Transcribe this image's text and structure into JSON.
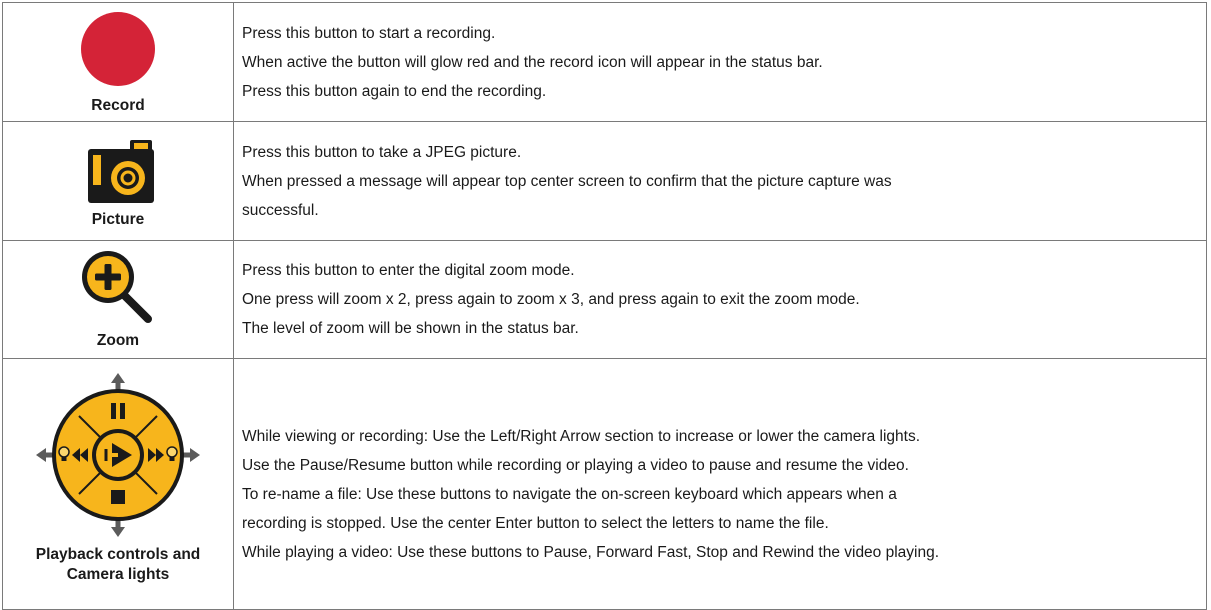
{
  "colors": {
    "record_red": "#d42337",
    "accent_yellow": "#f7b51c",
    "dark": "#1a1a1a",
    "pad_light": "#fbd66d",
    "arrow_gray": "#5b5b5b"
  },
  "rows": [
    {
      "icon": "record-icon",
      "label": "Record",
      "lines": [
        "Press this button to start a recording.",
        "When active the button will glow red and the record icon will appear in the status bar.",
        "Press this button again to end the recording."
      ]
    },
    {
      "icon": "camera-icon",
      "label": "Picture",
      "lines": [
        "Press this button to take a JPEG picture.",
        "When pressed a message will appear top center screen to confirm that the picture capture was",
        "successful."
      ]
    },
    {
      "icon": "zoom-icon",
      "label": "Zoom",
      "lines": [
        "Press this button to enter the digital zoom mode.",
        "One press will zoom x 2, press again to zoom x 3, and press again to exit the zoom mode.",
        "The level of zoom will be shown in the status bar."
      ]
    },
    {
      "icon": "playback-controls-icon",
      "label_line1": "Playback controls and",
      "label_line2": "Camera lights",
      "lines": [
        "While viewing or recording: Use the Left/Right Arrow section to increase or lower the camera lights.",
        "Use the Pause/Resume button while recording or playing a video to pause and resume the video.",
        "To re-name a file: Use these buttons to navigate the on-screen keyboard which appears when a",
        "recording is stopped. Use the center Enter button to select the letters to name the file.",
        "While playing a video: Use these buttons to Pause, Forward Fast, Stop and Rewind the video playing."
      ]
    }
  ]
}
